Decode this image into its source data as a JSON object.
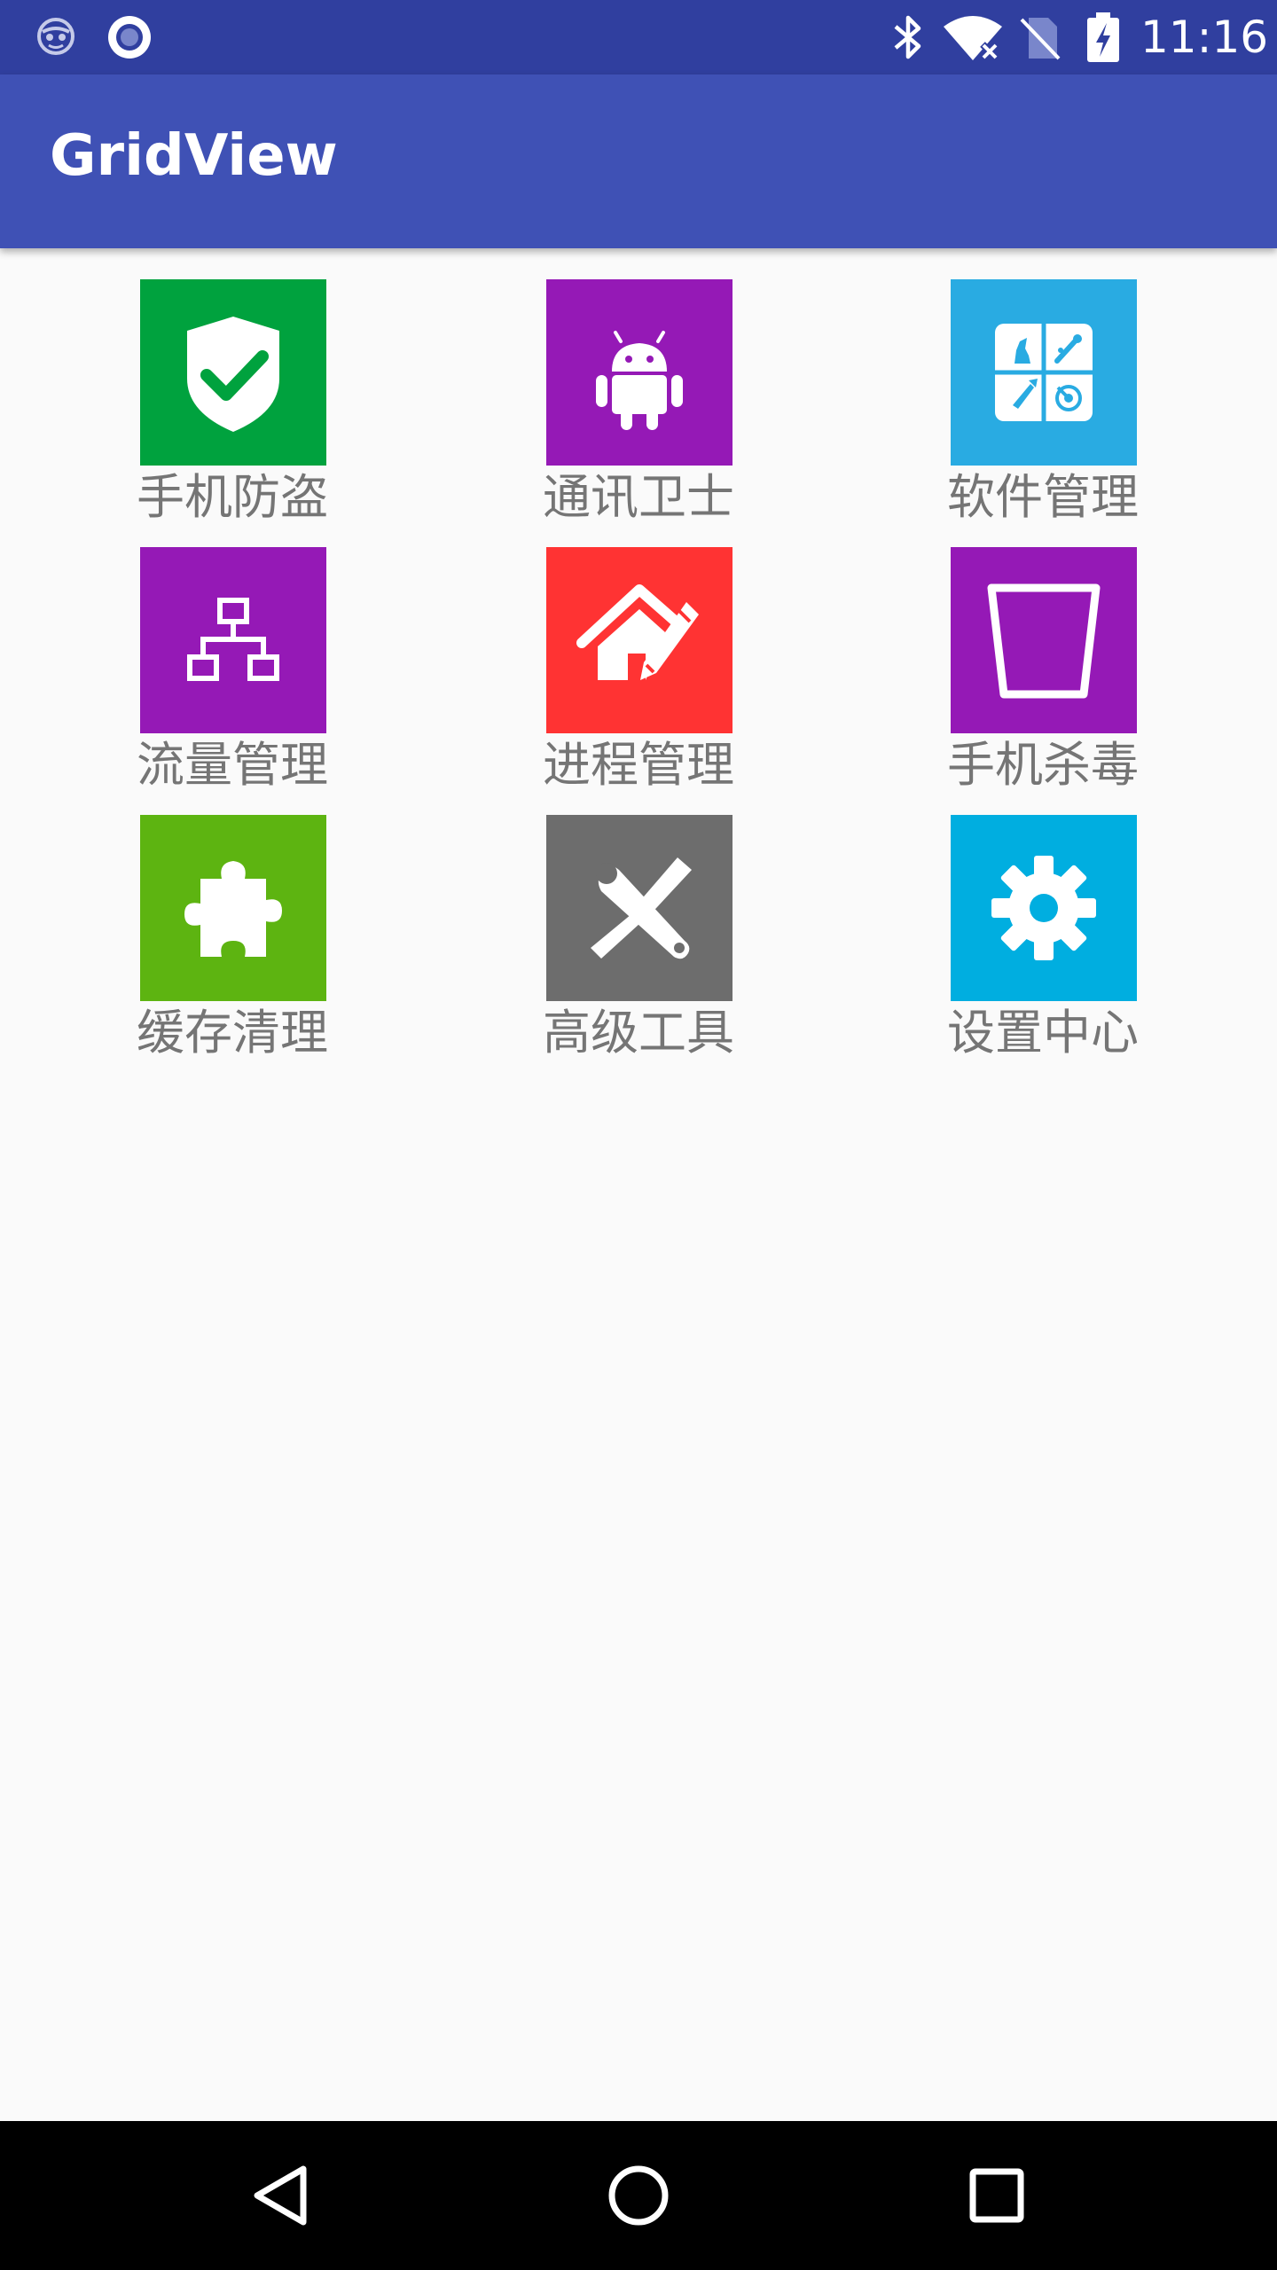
{
  "status_bar": {
    "time": "11:16",
    "icons": [
      "face-notification-icon",
      "record-notification-icon",
      "bluetooth-icon",
      "wifi-icon",
      "no-sim-icon",
      "battery-charging-icon"
    ]
  },
  "app_bar": {
    "title": "GridView",
    "color": "#3f51b5"
  },
  "grid": {
    "items": [
      {
        "label": "手机防盗",
        "icon": "shield-check-icon",
        "color": "#00a23e"
      },
      {
        "label": "通讯卫士",
        "icon": "android-icon",
        "color": "#9519b6"
      },
      {
        "label": "软件管理",
        "icon": "apps-grid-icon",
        "color": "#29abe2"
      },
      {
        "label": "流量管理",
        "icon": "network-icon",
        "color": "#9519b6"
      },
      {
        "label": "进程管理",
        "icon": "house-pencil-icon",
        "color": "#ff3333"
      },
      {
        "label": "手机杀毒",
        "icon": "trash-bin-icon",
        "color": "#9519b6"
      },
      {
        "label": "缓存清理",
        "icon": "puzzle-icon",
        "color": "#5db411"
      },
      {
        "label": "高级工具",
        "icon": "tools-icon",
        "color": "#6d6d6d"
      },
      {
        "label": "设置中心",
        "icon": "gear-icon",
        "color": "#00aee0"
      }
    ]
  },
  "nav_bar": {
    "buttons": [
      "back-icon",
      "home-icon",
      "recents-icon"
    ]
  }
}
